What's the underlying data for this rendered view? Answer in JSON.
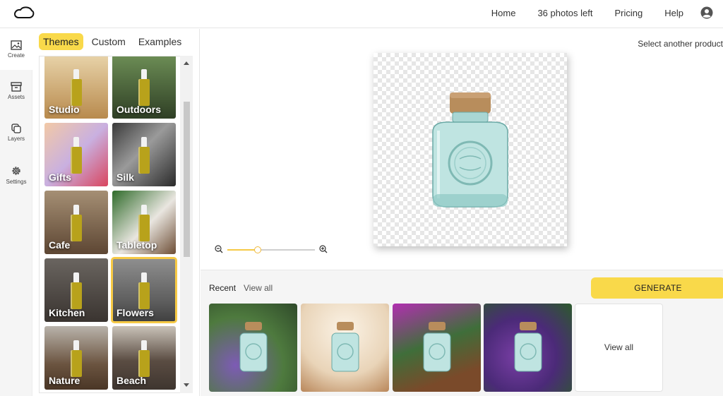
{
  "header": {
    "nav": [
      "Home",
      "36 photos left",
      "Pricing",
      "Help"
    ]
  },
  "rail": {
    "items": [
      {
        "label": "Create",
        "icon": "image-icon"
      },
      {
        "label": "Assets",
        "icon": "archive-icon"
      },
      {
        "label": "Layers",
        "icon": "layers-icon"
      },
      {
        "label": "Settings",
        "icon": "gear-icon"
      }
    ]
  },
  "panel": {
    "tabs": [
      "Themes",
      "Custom",
      "Examples"
    ],
    "active_tab": "Themes",
    "themes": [
      "Studio",
      "Outdoors",
      "Gifts",
      "Silk",
      "Cafe",
      "Tabletop",
      "Kitchen",
      "Flowers",
      "Nature",
      "Beach"
    ],
    "selected_theme": "Flowers"
  },
  "canvas": {
    "select_product_text": "Select another product",
    "zoom_level": 0.35
  },
  "recent": {
    "label": "Recent",
    "view_all_link": "View all",
    "generate_label": "GENERATE",
    "view_all_card": "View all"
  },
  "colors": {
    "accent": "#f9d94a",
    "selection": "#f6c945"
  }
}
